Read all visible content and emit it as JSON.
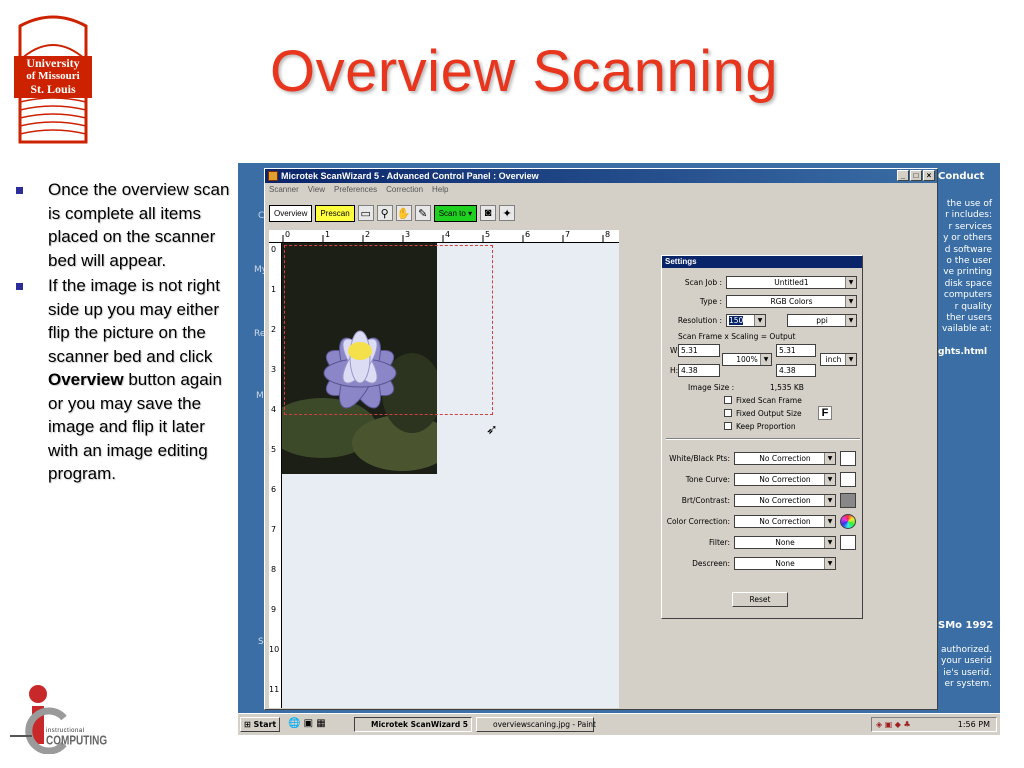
{
  "slide": {
    "title": "Overview Scanning",
    "bullets": [
      {
        "text": "Once the overview scan is complete all items placed on the scanner bed will appear."
      },
      {
        "text_before": "If the image is not right side up you may either flip the picture on the scanner bed and click ",
        "text_bold": "Overview",
        "text_after": " button again or you may save the image and flip it later with an image editing program."
      }
    ],
    "logo": {
      "line1": "University",
      "line2": "of Missouri",
      "line3": "St. Louis"
    },
    "footer_logo": {
      "line1": "instructional",
      "line2": "COMPUTING"
    }
  },
  "window": {
    "title": "Microtek ScanWizard 5 - Advanced Control Panel : Overview",
    "controls": {
      "minimize": "_",
      "maximize": "□",
      "close": "×"
    },
    "menu": [
      "Scanner",
      "View",
      "Preferences",
      "Correction",
      "Help"
    ],
    "toolbar": {
      "overview": "Overview",
      "prescan": "Prescan",
      "scan_to": "Scan to"
    },
    "ruler_top": [
      "0",
      "1",
      "2",
      "3",
      "4",
      "5",
      "6",
      "7",
      "8"
    ],
    "ruler_left": [
      "0",
      "1",
      "2",
      "3",
      "4",
      "5",
      "6",
      "7",
      "8",
      "9",
      "10",
      "11"
    ]
  },
  "settings": {
    "title": "Settings",
    "scan_job_label": "Scan Job :",
    "scan_job": "Untitled1",
    "type_label": "Type :",
    "type": "RGB Colors",
    "resolution_label": "Resolution :",
    "resolution": "150",
    "resolution_unit": "ppi",
    "frame_header": "Scan Frame  x  Scaling  =  Output",
    "w_label": "W:",
    "w_frame": "5.31",
    "w_output": "5.31",
    "scaling": "100%",
    "h_label": "H:",
    "h_frame": "4.38",
    "h_output": "4.38",
    "unit": "inch",
    "image_size_label": "Image Size :",
    "image_size": "1,535 KB",
    "fixed_scan_frame": "Fixed Scan Frame",
    "fixed_output_size": "Fixed Output Size",
    "keep_proportion": "Keep Proportion",
    "f_badge": "F",
    "white_black_label": "White/Black Pts:",
    "white_black": "No Correction",
    "tone_curve_label": "Tone Curve:",
    "tone_curve": "No Correction",
    "brt_contrast_label": "Brt/Contrast:",
    "brt_contrast": "No Correction",
    "color_correction_label": "Color Correction:",
    "color_correction": "No Correction",
    "filter_label": "Filter:",
    "filter": "None",
    "descreen_label": "Descreen:",
    "descreen": "None",
    "reset": "Reset"
  },
  "background_page": {
    "conduct": "Conduct",
    "lines": [
      "the use of",
      "r includes:",
      "r services",
      "y or others",
      "d software",
      "o the user",
      "ve printing",
      "disk space",
      "computers",
      "r quality",
      "ther users",
      "vailable at:"
    ],
    "link": "ghts.html",
    "year": "SMo 1992",
    "lines2": [
      "authorized.",
      "your userid",
      "ie's userid.",
      "er system."
    ],
    "left_letters": [
      "C",
      "My",
      "Re",
      "M",
      "S"
    ]
  },
  "taskbar": {
    "start": "Start",
    "tasks": [
      "Microtek ScanWizard 5",
      "overviewscaning.jpg - Paint"
    ],
    "clock": "1:56 PM"
  }
}
